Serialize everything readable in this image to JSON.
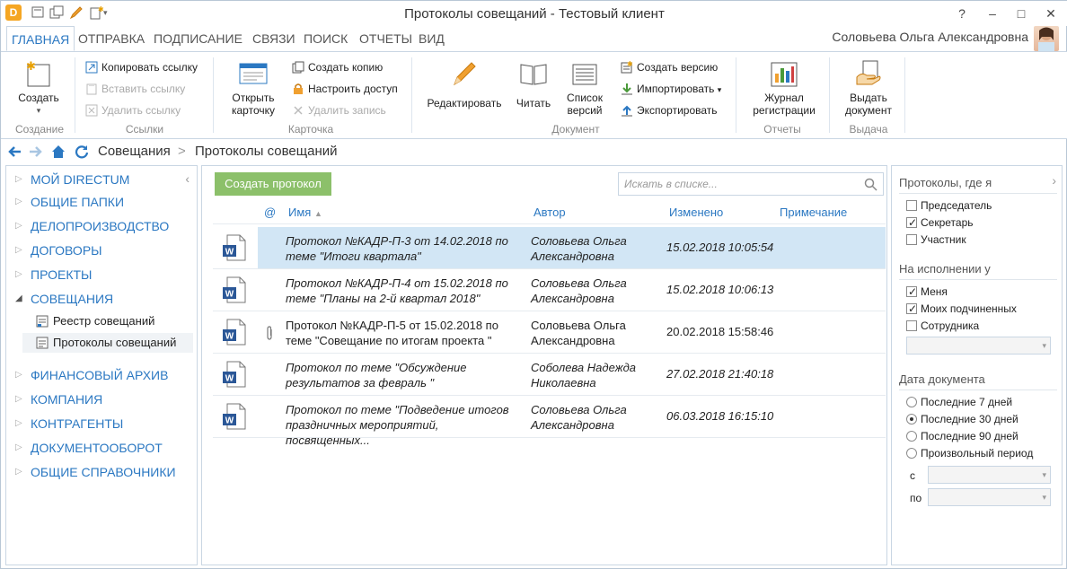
{
  "window": {
    "title": "Протоколы совещаний - Тестовый клиент",
    "help": "?",
    "minimize": "–",
    "maximize": "□",
    "close": "✕"
  },
  "tabs": [
    "ГЛАВНАЯ",
    "ОТПРАВКА",
    "ПОДПИСАНИЕ",
    "СВЯЗИ",
    "ПОИСК",
    "ОТЧЕТЫ",
    "ВИД"
  ],
  "user": {
    "name": "Соловьева Ольга Александровна"
  },
  "ribbon": {
    "groups": {
      "create": "Создание",
      "links": "Ссылки",
      "card": "Карточка",
      "document": "Документ",
      "reports": "Отчеты",
      "issue": "Выдача"
    },
    "create": "Создать",
    "create_arrow": "▾",
    "copy_link": "Копировать ссылку",
    "paste_link": "Вставить ссылку",
    "delete_link": "Удалить ссылку",
    "open_card_1": "Открыть",
    "open_card_2": "карточку",
    "create_copy": "Создать копию",
    "set_access": "Настроить доступ",
    "delete_record": "Удалить запись",
    "edit": "Редактировать",
    "read": "Читать",
    "versions_1": "Список",
    "versions_2": "версий",
    "create_version": "Создать версию",
    "import": "Импортировать",
    "import_arrow": "▾",
    "export": "Экспортировать",
    "journal_1": "Журнал",
    "journal_2": "регистрации",
    "issue_1": "Выдать",
    "issue_2": "документ"
  },
  "breadcrumb": {
    "root": "Совещания",
    "sep": ">",
    "current": "Протоколы совещаний"
  },
  "sidebar": {
    "collapse": "‹",
    "items": [
      {
        "label": "МОЙ DIRECTUM",
        "arrow": "▷"
      },
      {
        "label": "ОБЩИЕ ПАПКИ",
        "arrow": "▷"
      },
      {
        "label": "ДЕЛОПРОИЗВОДСТВО",
        "arrow": "▷"
      },
      {
        "label": "ДОГОВОРЫ",
        "arrow": "▷"
      },
      {
        "label": "ПРОЕКТЫ",
        "arrow": "▷"
      },
      {
        "label": "СОВЕЩАНИЯ",
        "arrow": "◢"
      },
      {
        "label": "ФИНАНСОВЫЙ АРХИВ",
        "arrow": "▷"
      },
      {
        "label": "КОМПАНИЯ",
        "arrow": "▷"
      },
      {
        "label": "КОНТРАГЕНТЫ",
        "arrow": "▷"
      },
      {
        "label": "ДОКУМЕНТООБОРОТ",
        "arrow": "▷"
      },
      {
        "label": "ОБЩИЕ СПРАВОЧНИКИ",
        "arrow": "▷"
      }
    ],
    "subitems": [
      "Реестр совещаний",
      "Протоколы совещаний"
    ]
  },
  "main": {
    "create_button": "Создать протокол",
    "search_placeholder": "Искать в списке...",
    "columns": {
      "attach": "@",
      "name": "Имя",
      "sort": "▲",
      "author": "Автор",
      "changed": "Изменено",
      "note": "Примечание"
    },
    "rows": [
      {
        "name": "Протокол №КАДР-П-3 от 14.02.2018 по теме \"Итоги квартала\"",
        "author": "Соловьева Ольга Александровна",
        "changed": "15.02.2018 10:05:54",
        "clip": ""
      },
      {
        "name": "Протокол №КАДР-П-4 от 15.02.2018 по теме \"Планы на 2-й квартал 2018\"",
        "author": "Соловьева Ольга Александровна",
        "changed": "15.02.2018 10:06:13",
        "clip": ""
      },
      {
        "name": "Протокол №КАДР-П-5 от 15.02.2018 по теме \"Совещание по итогам проекта \"",
        "author": "Соловьева Ольга Александровна",
        "changed": "20.02.2018 15:58:46",
        "clip": "🔗"
      },
      {
        "name": "Протокол по теме \"Обсуждение результатов за февраль \"",
        "author": "Соболева Надежда Николаевна",
        "changed": "27.02.2018 21:40:18",
        "clip": ""
      },
      {
        "name": "Протокол по теме \"Подведение итогов праздничных мероприятий, посвященных...",
        "author": "Соловьева Ольга Александровна",
        "changed": "06.03.2018 16:15:10",
        "clip": ""
      }
    ]
  },
  "filters": {
    "collapse": "›",
    "roles_title": "Протоколы, где я",
    "roles": [
      {
        "label": "Председатель",
        "checked": false
      },
      {
        "label": "Секретарь",
        "checked": true
      },
      {
        "label": "Участник",
        "checked": false
      }
    ],
    "exec_title": "На исполнении у",
    "exec": [
      {
        "label": "Меня",
        "checked": true
      },
      {
        "label": "Моих подчиненных",
        "checked": true
      },
      {
        "label": "Сотрудника",
        "checked": false
      }
    ],
    "date_title": "Дата документа",
    "dates": [
      {
        "label": "Последние 7 дней",
        "checked": false
      },
      {
        "label": "Последние 30 дней",
        "checked": true
      },
      {
        "label": "Последние 90 дней",
        "checked": false
      },
      {
        "label": "Произвольный период",
        "checked": false
      }
    ],
    "from_label": "с",
    "to_label": "по",
    "dropdown": "▾"
  }
}
